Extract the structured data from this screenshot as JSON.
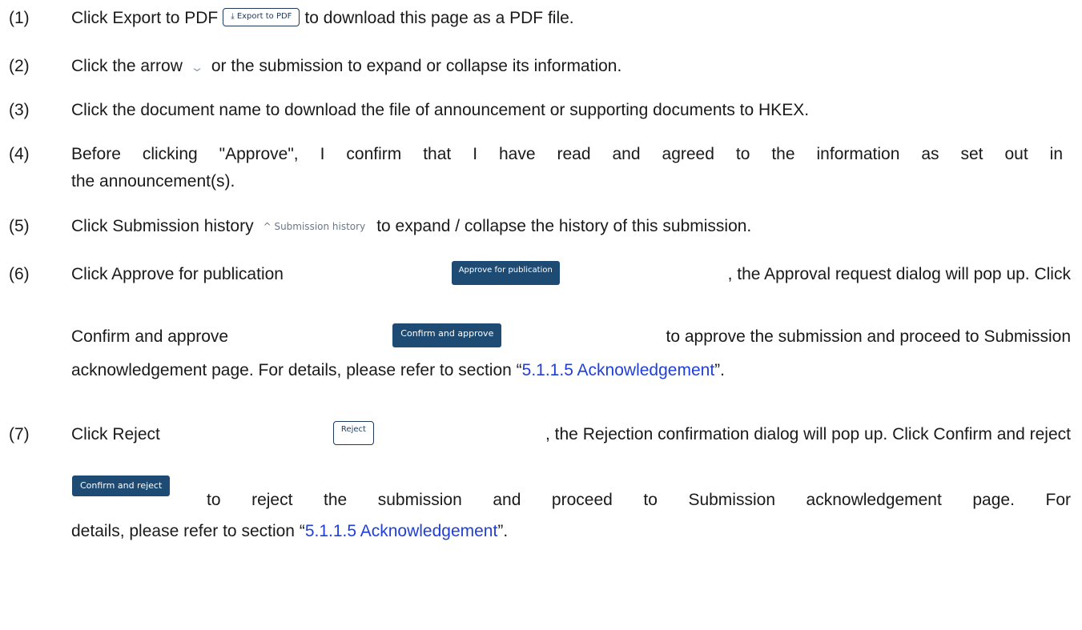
{
  "items": [
    {
      "num": "(1)",
      "a": "Click Export to PDF",
      "btn": "⤓ Export to PDF",
      "b": "to download this page as a PDF file."
    },
    {
      "num": "(2)",
      "a": "Click the arrow",
      "b": "or the submission to expand or collapse its information."
    },
    {
      "num": "(3)",
      "text": "Click the document name to download the file of announcement or supporting documents to HKEX."
    },
    {
      "num": "(4)",
      "line1": "Before clicking \"Approve\", I confirm that I have read and agreed to the information as set out in",
      "line2": "the announcement(s)."
    },
    {
      "num": "(5)",
      "a": "Click Submission history",
      "btn": "^ Submission history",
      "b": "to expand / collapse the history of this submission."
    },
    {
      "num": "(6)",
      "a": "Click Approve for publication",
      "btn": "Approve for publication",
      "b": ", the Approval request dialog will pop up. Click",
      "c": "Confirm and approve",
      "btn2": "Confirm and approve",
      "d": "to approve the submission and proceed to Submission",
      "e": "acknowledgement page. For details, please refer to section “",
      "link": "5.1.1.5 Acknowledgement",
      "f": "”."
    },
    {
      "num": "(7)",
      "a": "Click Reject",
      "btn": "Reject",
      "b": ", the Rejection confirmation dialog will pop up. Click Confirm and reject",
      "btn2": "Confirm and reject",
      "d": "to reject the submission and proceed to Submission acknowledgement page. For",
      "e": "details, please refer to section “",
      "link": "5.1.1.5 Acknowledgement",
      "f": "”."
    }
  ],
  "icons": {
    "arrow": "chevron-down-icon",
    "export": "download-icon"
  },
  "colors": {
    "link": "#1f3fd6",
    "button": "#1e4b74"
  }
}
